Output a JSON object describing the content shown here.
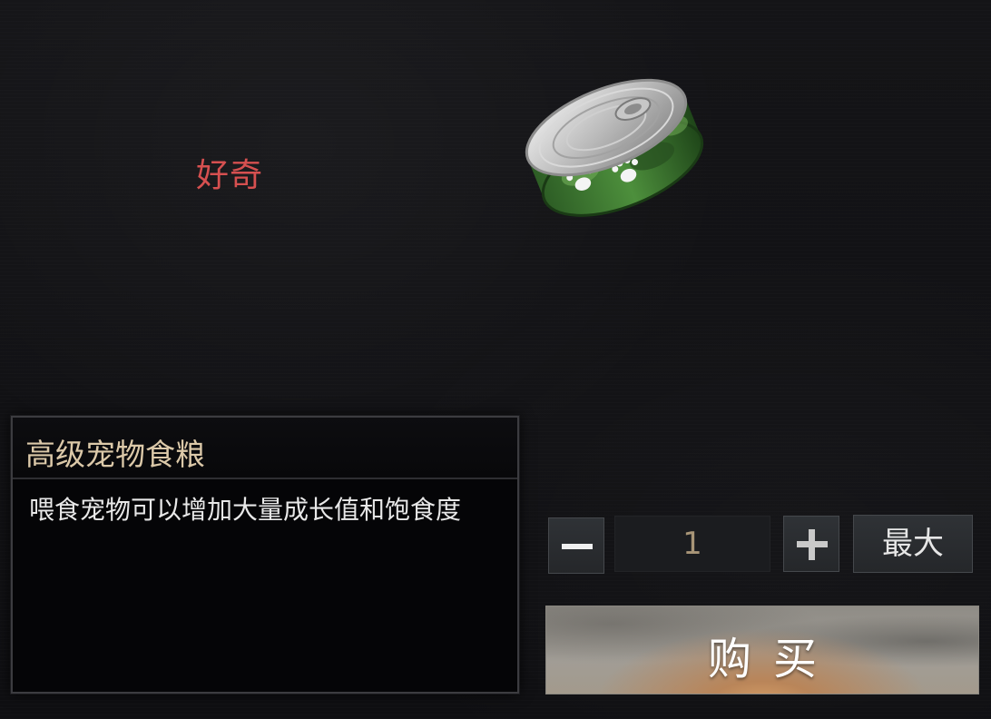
{
  "pet": {
    "mood": "好奇"
  },
  "item": {
    "name": "高级宠物食粮",
    "description": "喂食宠物可以增加大量成长值和饱食度",
    "icon": "pet-food-can-icon"
  },
  "purchase": {
    "quantity": "1",
    "max_label": "最大",
    "buy_label": "购买"
  },
  "colors": {
    "mood": "#d65050",
    "item_title": "#dcc9a9",
    "quantity": "#a89577",
    "can_green": "#3f7b34"
  }
}
